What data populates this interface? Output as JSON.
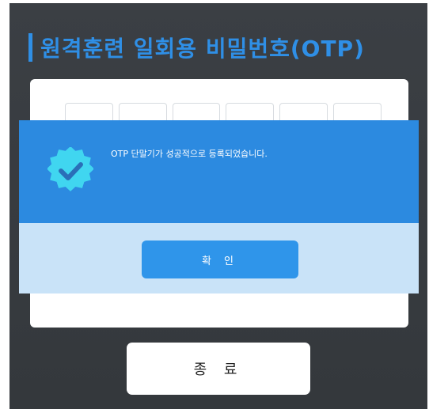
{
  "header": {
    "title": "원격훈련 일회용 비밀번호(OTP)"
  },
  "otp": {
    "cell_count": 6
  },
  "dialog": {
    "icon": "verified-check-badge-icon",
    "message": "OTP 단말기가 성공적으로 등록되었습니다.",
    "confirm_label": "확 인"
  },
  "footer": {
    "close_label": "종 료"
  },
  "colors": {
    "background": "#3b3f44",
    "accent": "#2f8fe6",
    "dialog_top": "#2c8ae0",
    "dialog_bottom": "#c9e3f8",
    "badge": "#40d6f0"
  }
}
